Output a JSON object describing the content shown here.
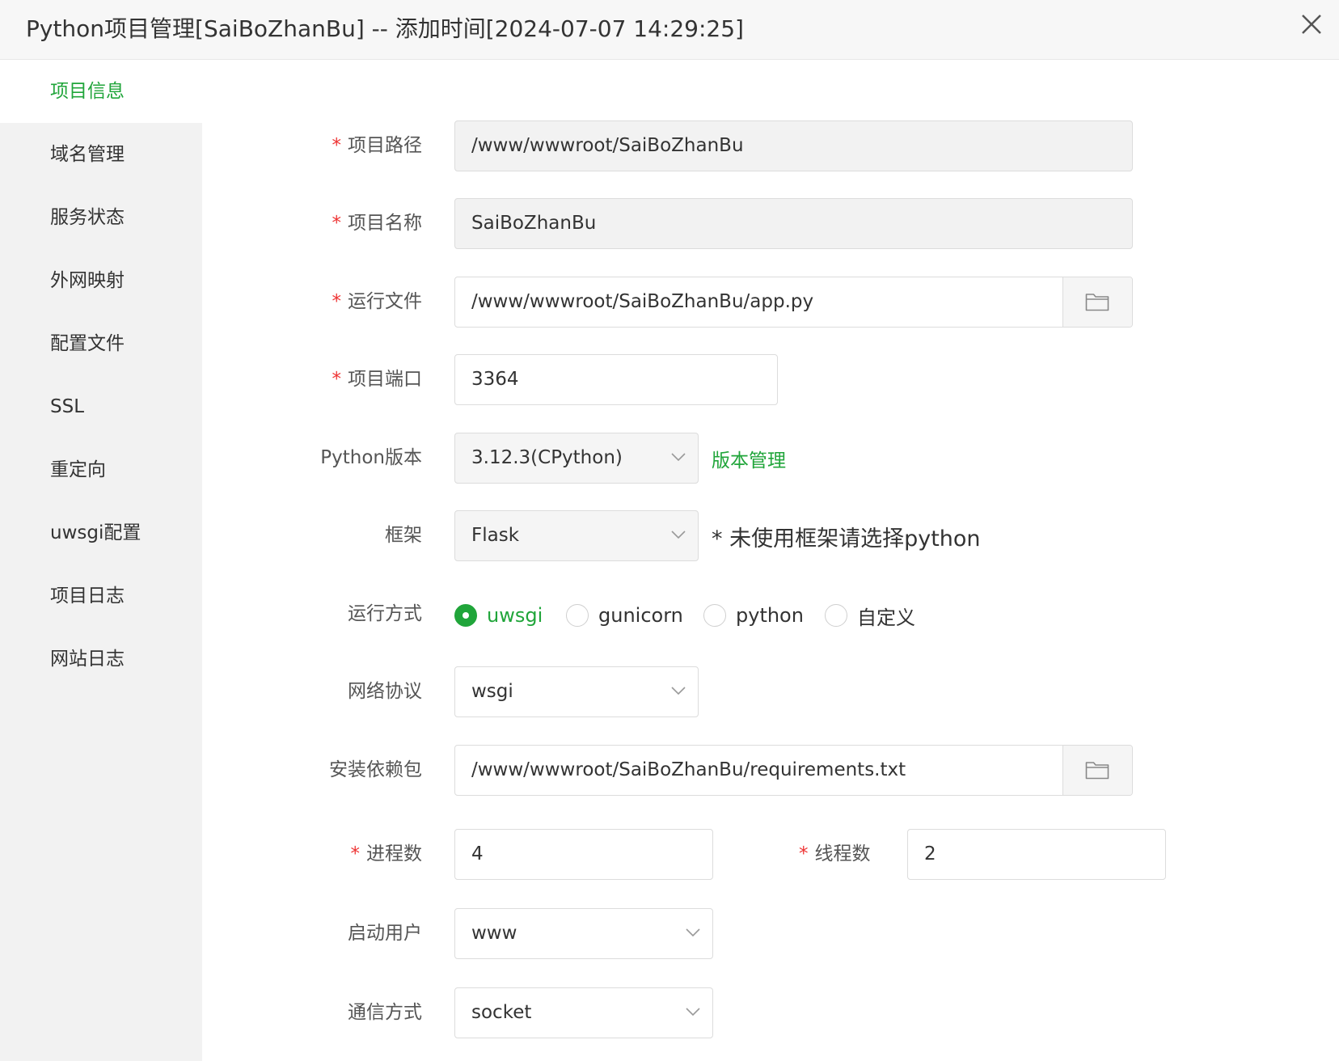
{
  "window": {
    "title": "Python项目管理[SaiBoZhanBu] -- 添加时间[2024-07-07 14:29:25]"
  },
  "sidebar": {
    "items": [
      {
        "label": "项目信息"
      },
      {
        "label": "域名管理"
      },
      {
        "label": "服务状态"
      },
      {
        "label": "外网映射"
      },
      {
        "label": "配置文件"
      },
      {
        "label": "SSL"
      },
      {
        "label": "重定向"
      },
      {
        "label": "uwsgi配置"
      },
      {
        "label": "项目日志"
      },
      {
        "label": "网站日志"
      }
    ],
    "active_index": 0
  },
  "form": {
    "required_mark": "*",
    "project_path": {
      "label": "项目路径",
      "value": "/www/wwwroot/SaiBoZhanBu"
    },
    "project_name": {
      "label": "项目名称",
      "value": "SaiBoZhanBu"
    },
    "run_file": {
      "label": "运行文件",
      "value": "/www/wwwroot/SaiBoZhanBu/app.py"
    },
    "project_port": {
      "label": "项目端口",
      "value": "3364"
    },
    "python_version": {
      "label": "Python版本",
      "value": "3.12.3(CPython)",
      "link": "版本管理"
    },
    "framework": {
      "label": "框架",
      "value": "Flask",
      "hint": "* 未使用框架请选择python"
    },
    "run_mode": {
      "label": "运行方式",
      "options": [
        "uwsgi",
        "gunicorn",
        "python",
        "自定义"
      ],
      "selected": "uwsgi"
    },
    "network_protocol": {
      "label": "网络协议",
      "value": "wsgi"
    },
    "install_deps": {
      "label": "安装依赖包",
      "value": "/www/wwwroot/SaiBoZhanBu/requirements.txt"
    },
    "processes": {
      "label": "进程数",
      "value": "4"
    },
    "threads": {
      "label": "线程数",
      "value": "2"
    },
    "start_user": {
      "label": "启动用户",
      "value": "www"
    },
    "comm_mode": {
      "label": "通信方式",
      "value": "socket"
    }
  },
  "colors": {
    "accent": "#20a53a",
    "required": "#ee3333"
  }
}
